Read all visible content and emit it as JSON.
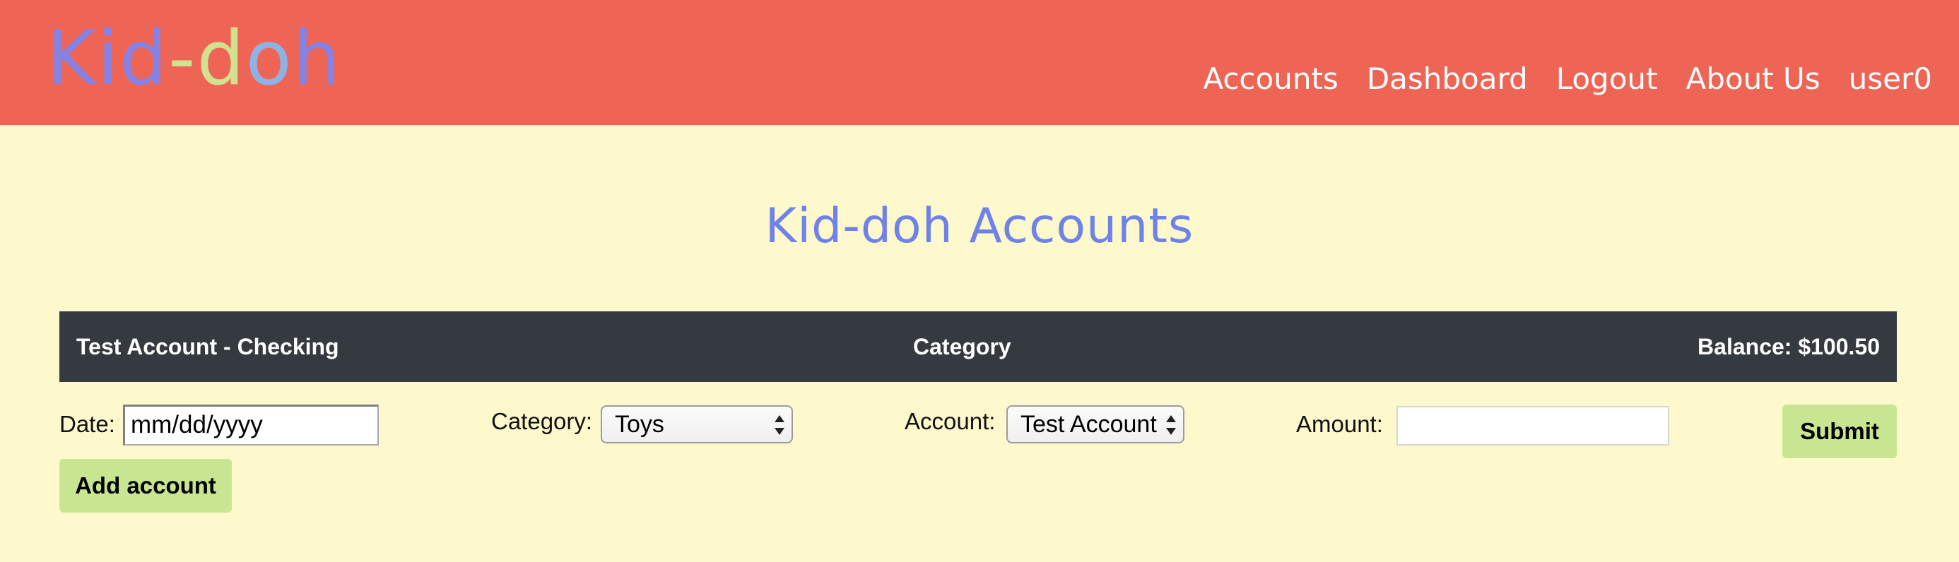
{
  "header": {
    "logo": {
      "part1": "Kid",
      "part2": "-",
      "part3": "d",
      "part4": "o",
      "part5": "h"
    },
    "nav": [
      "Accounts",
      "Dashboard",
      "Logout",
      "About Us",
      "user0"
    ]
  },
  "main": {
    "title": "Kid-doh Accounts"
  },
  "account_bar": {
    "name": "Test Account - Checking",
    "category_header": "Category",
    "balance": "Balance: $100.50"
  },
  "form": {
    "date_label": "Date:",
    "date_placeholder": "mm/dd/yyyy",
    "category_label": "Category:",
    "category_value": "Toys",
    "account_label": "Account:",
    "account_value": "Test Account",
    "amount_label": "Amount:",
    "amount_value": "",
    "submit_label": "Submit",
    "add_account_label": "Add account"
  },
  "colors": {
    "header_bg": "#ee6555",
    "page_bg": "#fef9cc",
    "title": "#6f82e8",
    "account_bar_bg": "#353a40",
    "button_bg": "#c8e691",
    "logo_purple": "#8582e4",
    "logo_green": "#d0e290",
    "logo_blue": "#8fb2e6"
  }
}
